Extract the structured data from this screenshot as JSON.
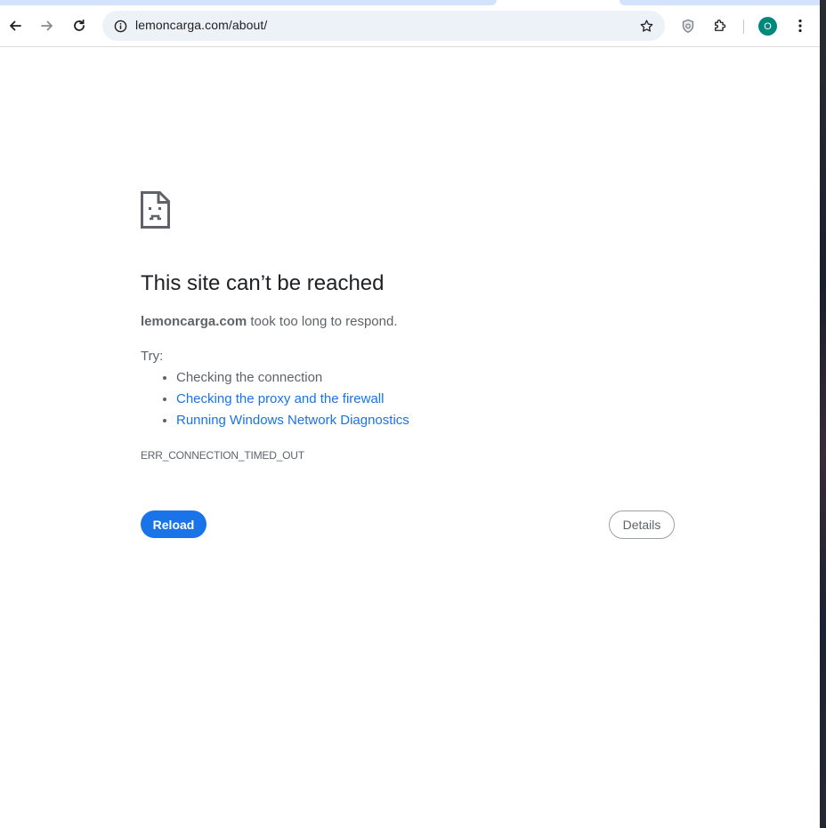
{
  "toolbar": {
    "back_icon": "arrow-left-icon",
    "forward_icon": "arrow-right-icon",
    "reload_icon": "reload-icon",
    "url": "lemoncarga.com/about/",
    "site_info_icon": "info-icon",
    "bookmark_icon": "star-icon",
    "extension_shield_icon": "shield-icon",
    "extensions_icon": "puzzle-icon",
    "profile_initial": "O",
    "menu_icon": "vertical-dots-icon"
  },
  "error": {
    "icon": "sad-document-icon",
    "title": "This site can’t be reached",
    "host": "lemoncarga.com",
    "message": " took too long to respond.",
    "try_label": "Try:",
    "suggestions": [
      "Checking the connection",
      "Checking the proxy and the firewall",
      "Running Windows Network Diagnostics"
    ],
    "code": "ERR_CONNECTION_TIMED_OUT",
    "reload_label": "Reload",
    "details_label": "Details"
  },
  "colors": {
    "accent": "#1a73e8",
    "avatar": "#00897b",
    "text_secondary": "#5f6368",
    "title": "#202124"
  }
}
